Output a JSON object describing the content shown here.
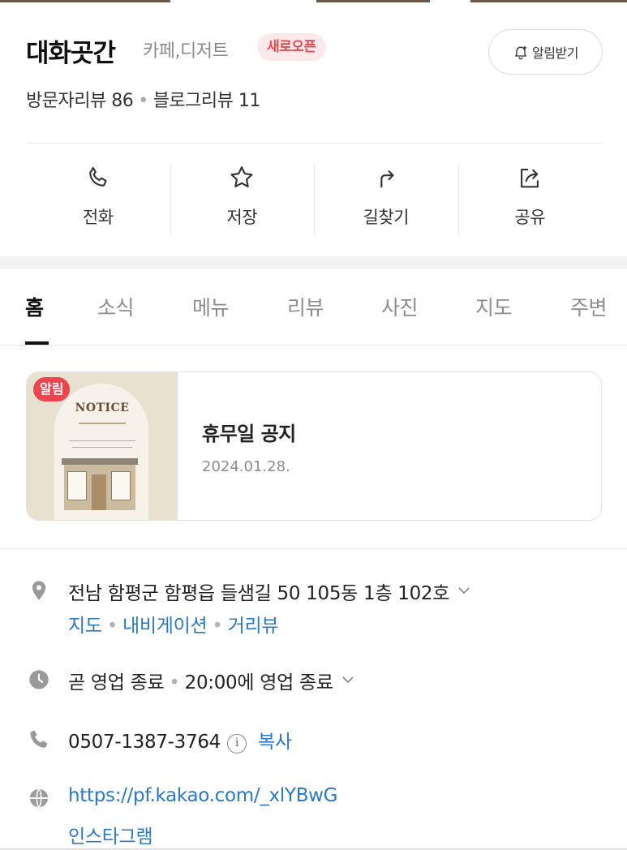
{
  "place": {
    "name": "대화곳간",
    "category": "카페,디저트",
    "badge": "새로오픈",
    "alarm_button": "알림받기"
  },
  "reviews": {
    "visitor": "방문자리뷰 86",
    "blog": "블로그리뷰 11"
  },
  "actions": [
    {
      "label": "전화",
      "icon": "phone-icon"
    },
    {
      "label": "저장",
      "icon": "star-icon"
    },
    {
      "label": "길찾기",
      "icon": "directions-icon"
    },
    {
      "label": "공유",
      "icon": "share-icon"
    }
  ],
  "tabs": [
    {
      "label": "홈",
      "active": true
    },
    {
      "label": "소식",
      "active": false
    },
    {
      "label": "메뉴",
      "active": false
    },
    {
      "label": "리뷰",
      "active": false
    },
    {
      "label": "사진",
      "active": false
    },
    {
      "label": "지도",
      "active": false
    },
    {
      "label": "주변",
      "active": false
    }
  ],
  "notice": {
    "badge": "알림",
    "thumb_word": "NOTICE",
    "title": "휴무일 공지",
    "date": "2024.01.28."
  },
  "info": {
    "address": "전남 함평군 함평읍 들샘길 50 105동 1층 102호",
    "address_links": [
      "지도",
      "내비게이션",
      "거리뷰"
    ],
    "hours_status": "곧 영업 종료",
    "hours_detail": "20:00에 영업 종료",
    "phone": "0507-1387-3764",
    "copy_label": "복사",
    "info_glyph": "i",
    "website": "https://pf.kakao.com/_xlYBwG",
    "instagram": "인스타그램"
  },
  "colors": {
    "link": "#2a78c8",
    "badge_red": "#e84a54",
    "badge_bg": "#fde9ea",
    "active_tab": "#111111",
    "inactive_tab": "#8d8d8d"
  }
}
